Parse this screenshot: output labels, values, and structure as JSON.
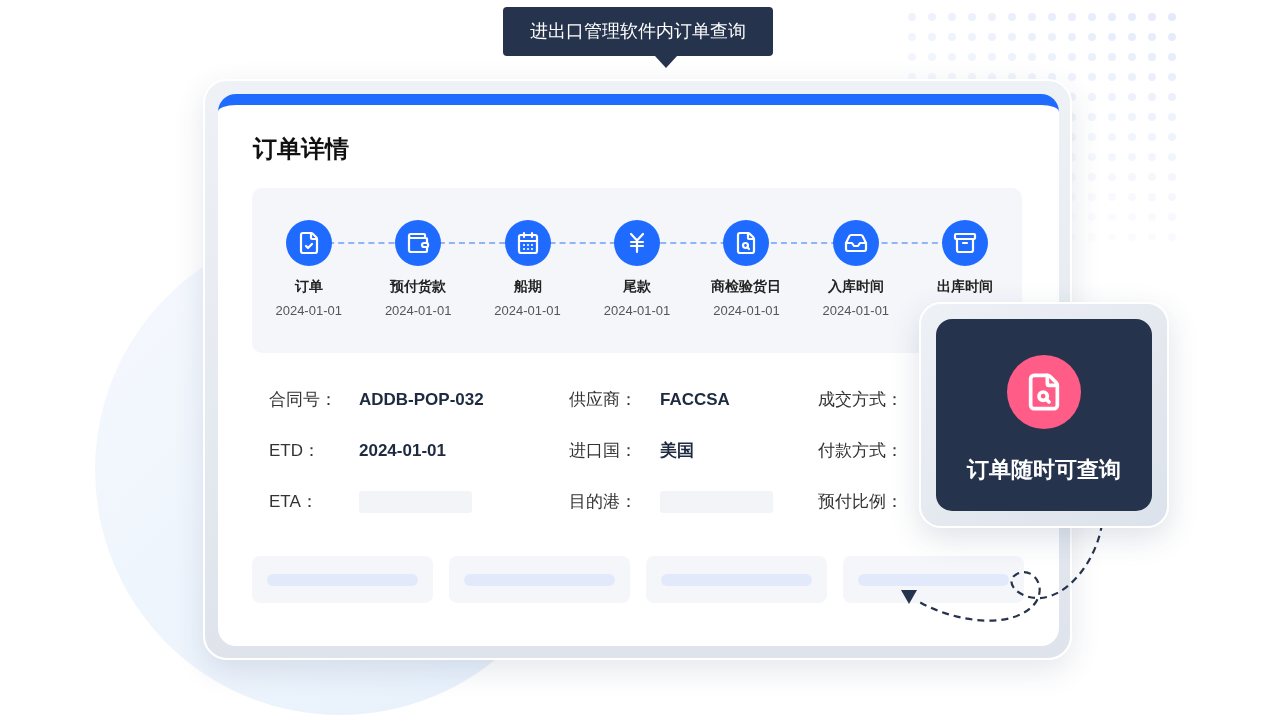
{
  "tooltip": {
    "text": "进出口管理软件内订单查询"
  },
  "card": {
    "title": "订单详情",
    "steps": [
      {
        "label": "订单",
        "date": "2024-01-01"
      },
      {
        "label": "预付货款",
        "date": "2024-01-01"
      },
      {
        "label": "船期",
        "date": "2024-01-01"
      },
      {
        "label": "尾款",
        "date": "2024-01-01"
      },
      {
        "label": "商检验货日",
        "date": "2024-01-01"
      },
      {
        "label": "入库时间",
        "date": "2024-01-01"
      },
      {
        "label": "出库时间"
      }
    ],
    "fields": [
      {
        "label": "合同号：",
        "kind": "text",
        "value": "ADDB-POP-032"
      },
      {
        "label": "供应商：",
        "kind": "text",
        "value": "FACCSA"
      },
      {
        "label": "成交方式：",
        "kind": "hidden"
      },
      {
        "label": "ETD：",
        "kind": "text",
        "value": "2024-01-01"
      },
      {
        "label": "进口国：",
        "kind": "text",
        "value": "美国"
      },
      {
        "label": "付款方式：",
        "kind": "hidden"
      },
      {
        "label": "ETA：",
        "kind": "blank"
      },
      {
        "label": "目的港：",
        "kind": "blank"
      },
      {
        "label": "预付比例：",
        "kind": "hidden"
      }
    ]
  },
  "callout": {
    "text": "订单随时可查询"
  }
}
